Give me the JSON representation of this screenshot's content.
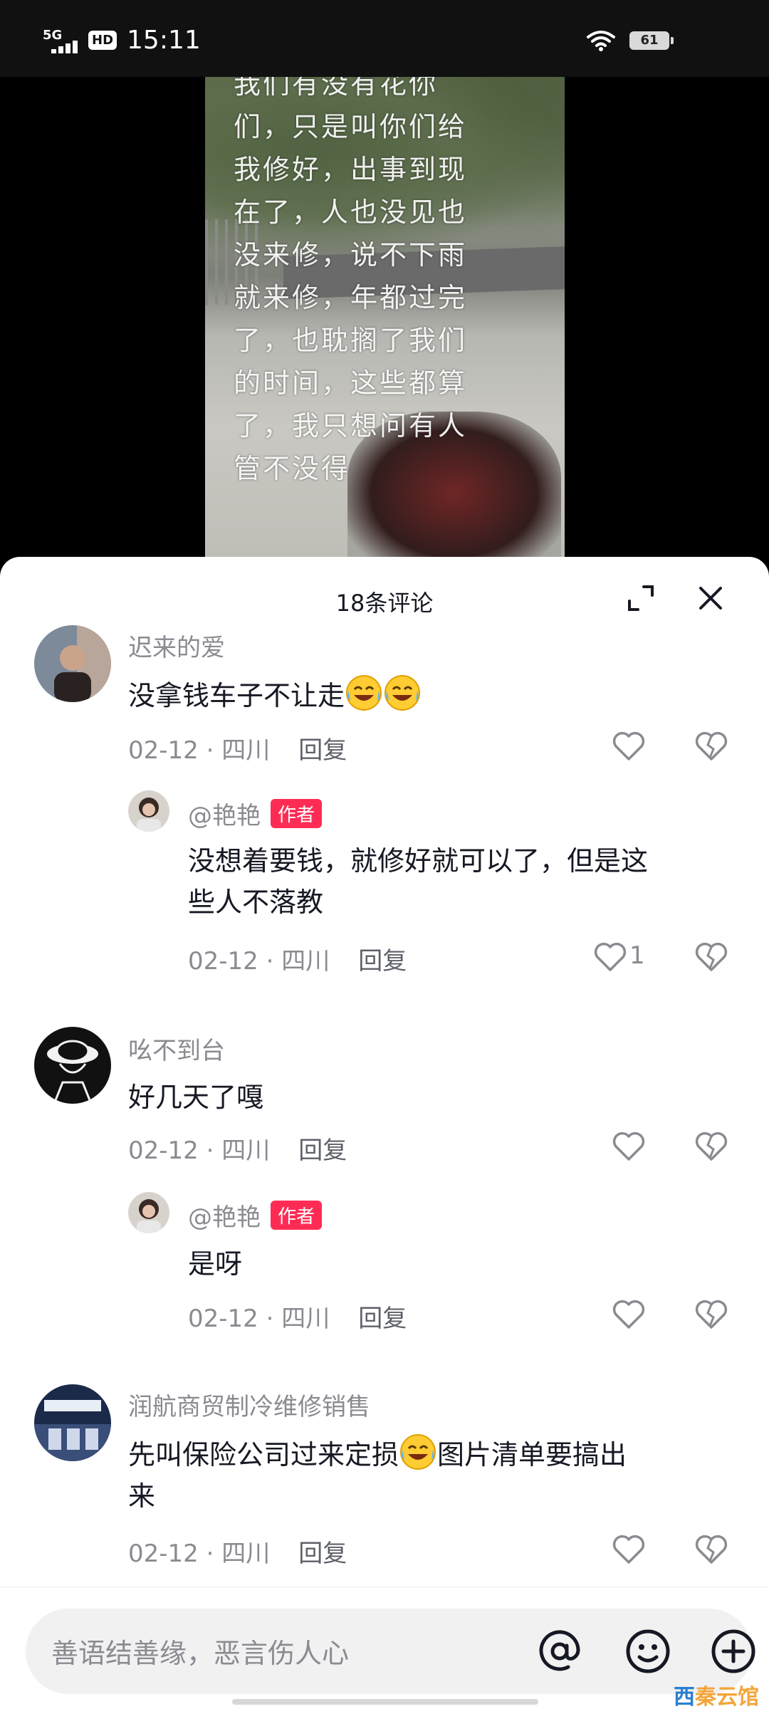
{
  "status_bar": {
    "network": "5G",
    "hd": "HD",
    "time": "15:11",
    "battery": "61"
  },
  "video": {
    "overlay_lines": [
      "我们有没有花你",
      "们，只是叫你们给",
      "我修好，出事到现",
      "在了，人也没见也",
      "没来修，说不下雨",
      "就来修，年都过完",
      "了，也耽搁了我们",
      "的时间，这些都算",
      "了，我只想问有人",
      "管不没得"
    ]
  },
  "sheet": {
    "title": "18条评论"
  },
  "comments": [
    {
      "username": "迟来的爱",
      "text": "没拿钱车子不让走",
      "emojis": 2,
      "date": "02-12",
      "location": "四川",
      "reply_label": "回复",
      "replies": [
        {
          "username": "@艳艳",
          "badge": "作者",
          "text_line1": "没想着要钱，就修好就可以了，但是这",
          "text_line2": "些人不落教",
          "date": "02-12",
          "location": "四川",
          "reply_label": "回复",
          "likes": "1"
        }
      ]
    },
    {
      "username": "吆不到台",
      "text": "好几天了嘎",
      "date": "02-12",
      "location": "四川",
      "reply_label": "回复",
      "replies": [
        {
          "username": "@艳艳",
          "badge": "作者",
          "text": "是呀",
          "date": "02-12",
          "location": "四川",
          "reply_label": "回复"
        }
      ]
    },
    {
      "username": "润航商贸制冷维修销售",
      "text_part1": "先叫保险公司过来定损",
      "text_part2": "图片清单要搞出",
      "text_line2": "来",
      "date": "02-12",
      "location": "四川",
      "reply_label": "回复"
    }
  ],
  "input": {
    "placeholder": "善语结善缘，恶言伤人心"
  },
  "watermark": {
    "part1": "西",
    "part2": "秦云馆"
  },
  "colors": {
    "author_badge": "#fe2c55",
    "watermark_orange": "#f3a53a",
    "watermark_blue": "#2a7fd0"
  }
}
